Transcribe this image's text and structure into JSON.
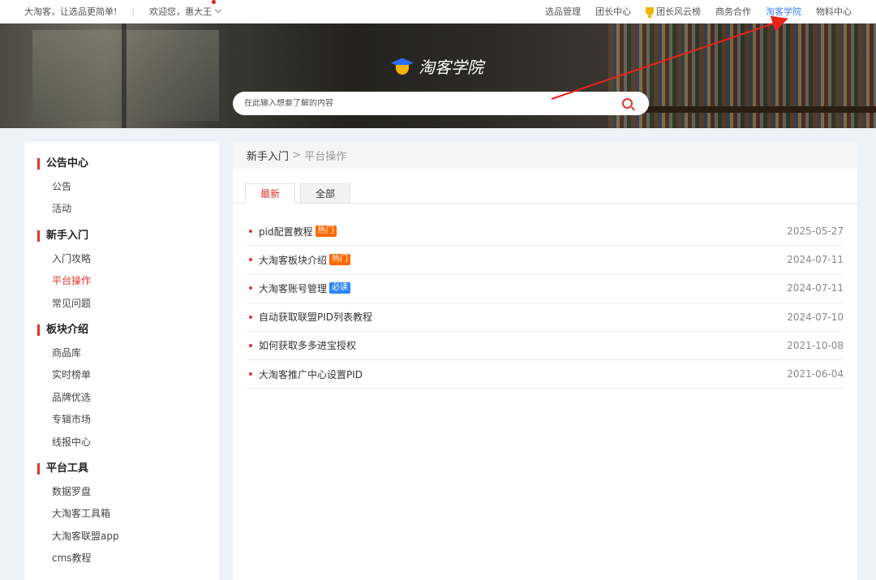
{
  "topbar": {
    "slogan": "大淘客，让选品更简单!",
    "welcome": "欢迎您，惠大王",
    "nav": [
      {
        "label": "选品管理"
      },
      {
        "label": "团长中心"
      },
      {
        "label": "团长风云榜"
      },
      {
        "label": "商务合作"
      },
      {
        "label": "淘客学院"
      },
      {
        "label": "物料中心"
      }
    ]
  },
  "hero": {
    "title": "淘客学院",
    "search_placeholder": "在此输入想要了解的内容"
  },
  "sidebar": {
    "groups": [
      {
        "title": "公告中心",
        "items": [
          "公告",
          "活动"
        ]
      },
      {
        "title": "新手入门",
        "items": [
          "入门攻略",
          "平台操作",
          "常见问题"
        ]
      },
      {
        "title": "板块介绍",
        "items": [
          "商品库",
          "实时榜单",
          "品牌优选",
          "专辑市场",
          "线报中心"
        ]
      },
      {
        "title": "平台工具",
        "items": [
          "数据罗盘",
          "大淘客工具箱",
          "大淘客联盟app",
          "cms教程"
        ]
      }
    ]
  },
  "main": {
    "breadcrumb": {
      "parent": "新手入门",
      "sep": " > ",
      "current": "平台操作"
    },
    "tabs": [
      "最新",
      "全部"
    ],
    "articles": [
      {
        "title": "pid配置教程",
        "badge": "热门",
        "badge_type": "hot",
        "date": "2025-05-27"
      },
      {
        "title": "大淘客板块介绍",
        "badge": "热门",
        "badge_type": "hot",
        "date": "2024-07-11"
      },
      {
        "title": "大淘客账号管理",
        "badge": "必读",
        "badge_type": "must",
        "date": "2024-07-11"
      },
      {
        "title": "自动获取联盟PID列表教程",
        "badge": "",
        "badge_type": "",
        "date": "2024-07-10"
      },
      {
        "title": "如何获取多多进宝授权",
        "badge": "",
        "badge_type": "",
        "date": "2021-10-08"
      },
      {
        "title": "大淘客推广中心设置PID",
        "badge": "",
        "badge_type": "",
        "date": "2021-06-04"
      }
    ]
  },
  "colors": {
    "accent": "#e0362c",
    "link_active": "#3d7ef5",
    "hot": "#ff6a00",
    "must": "#2f86f6"
  }
}
